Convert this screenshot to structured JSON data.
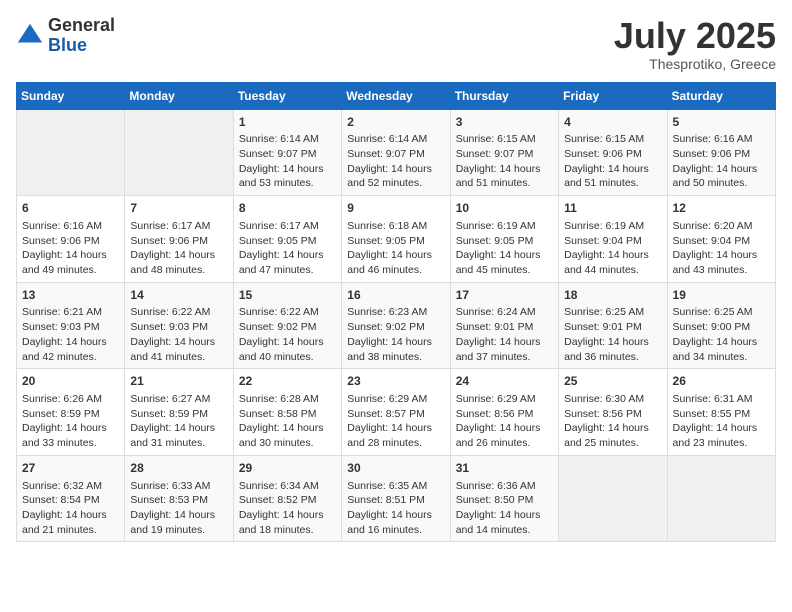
{
  "header": {
    "logo_general": "General",
    "logo_blue": "Blue",
    "month_year": "July 2025",
    "location": "Thesprotiko, Greece"
  },
  "weekdays": [
    "Sunday",
    "Monday",
    "Tuesday",
    "Wednesday",
    "Thursday",
    "Friday",
    "Saturday"
  ],
  "weeks": [
    [
      {
        "day": "",
        "sunrise": "",
        "sunset": "",
        "daylight": ""
      },
      {
        "day": "",
        "sunrise": "",
        "sunset": "",
        "daylight": ""
      },
      {
        "day": "1",
        "sunrise": "Sunrise: 6:14 AM",
        "sunset": "Sunset: 9:07 PM",
        "daylight": "Daylight: 14 hours and 53 minutes."
      },
      {
        "day": "2",
        "sunrise": "Sunrise: 6:14 AM",
        "sunset": "Sunset: 9:07 PM",
        "daylight": "Daylight: 14 hours and 52 minutes."
      },
      {
        "day": "3",
        "sunrise": "Sunrise: 6:15 AM",
        "sunset": "Sunset: 9:07 PM",
        "daylight": "Daylight: 14 hours and 51 minutes."
      },
      {
        "day": "4",
        "sunrise": "Sunrise: 6:15 AM",
        "sunset": "Sunset: 9:06 PM",
        "daylight": "Daylight: 14 hours and 51 minutes."
      },
      {
        "day": "5",
        "sunrise": "Sunrise: 6:16 AM",
        "sunset": "Sunset: 9:06 PM",
        "daylight": "Daylight: 14 hours and 50 minutes."
      }
    ],
    [
      {
        "day": "6",
        "sunrise": "Sunrise: 6:16 AM",
        "sunset": "Sunset: 9:06 PM",
        "daylight": "Daylight: 14 hours and 49 minutes."
      },
      {
        "day": "7",
        "sunrise": "Sunrise: 6:17 AM",
        "sunset": "Sunset: 9:06 PM",
        "daylight": "Daylight: 14 hours and 48 minutes."
      },
      {
        "day": "8",
        "sunrise": "Sunrise: 6:17 AM",
        "sunset": "Sunset: 9:05 PM",
        "daylight": "Daylight: 14 hours and 47 minutes."
      },
      {
        "day": "9",
        "sunrise": "Sunrise: 6:18 AM",
        "sunset": "Sunset: 9:05 PM",
        "daylight": "Daylight: 14 hours and 46 minutes."
      },
      {
        "day": "10",
        "sunrise": "Sunrise: 6:19 AM",
        "sunset": "Sunset: 9:05 PM",
        "daylight": "Daylight: 14 hours and 45 minutes."
      },
      {
        "day": "11",
        "sunrise": "Sunrise: 6:19 AM",
        "sunset": "Sunset: 9:04 PM",
        "daylight": "Daylight: 14 hours and 44 minutes."
      },
      {
        "day": "12",
        "sunrise": "Sunrise: 6:20 AM",
        "sunset": "Sunset: 9:04 PM",
        "daylight": "Daylight: 14 hours and 43 minutes."
      }
    ],
    [
      {
        "day": "13",
        "sunrise": "Sunrise: 6:21 AM",
        "sunset": "Sunset: 9:03 PM",
        "daylight": "Daylight: 14 hours and 42 minutes."
      },
      {
        "day": "14",
        "sunrise": "Sunrise: 6:22 AM",
        "sunset": "Sunset: 9:03 PM",
        "daylight": "Daylight: 14 hours and 41 minutes."
      },
      {
        "day": "15",
        "sunrise": "Sunrise: 6:22 AM",
        "sunset": "Sunset: 9:02 PM",
        "daylight": "Daylight: 14 hours and 40 minutes."
      },
      {
        "day": "16",
        "sunrise": "Sunrise: 6:23 AM",
        "sunset": "Sunset: 9:02 PM",
        "daylight": "Daylight: 14 hours and 38 minutes."
      },
      {
        "day": "17",
        "sunrise": "Sunrise: 6:24 AM",
        "sunset": "Sunset: 9:01 PM",
        "daylight": "Daylight: 14 hours and 37 minutes."
      },
      {
        "day": "18",
        "sunrise": "Sunrise: 6:25 AM",
        "sunset": "Sunset: 9:01 PM",
        "daylight": "Daylight: 14 hours and 36 minutes."
      },
      {
        "day": "19",
        "sunrise": "Sunrise: 6:25 AM",
        "sunset": "Sunset: 9:00 PM",
        "daylight": "Daylight: 14 hours and 34 minutes."
      }
    ],
    [
      {
        "day": "20",
        "sunrise": "Sunrise: 6:26 AM",
        "sunset": "Sunset: 8:59 PM",
        "daylight": "Daylight: 14 hours and 33 minutes."
      },
      {
        "day": "21",
        "sunrise": "Sunrise: 6:27 AM",
        "sunset": "Sunset: 8:59 PM",
        "daylight": "Daylight: 14 hours and 31 minutes."
      },
      {
        "day": "22",
        "sunrise": "Sunrise: 6:28 AM",
        "sunset": "Sunset: 8:58 PM",
        "daylight": "Daylight: 14 hours and 30 minutes."
      },
      {
        "day": "23",
        "sunrise": "Sunrise: 6:29 AM",
        "sunset": "Sunset: 8:57 PM",
        "daylight": "Daylight: 14 hours and 28 minutes."
      },
      {
        "day": "24",
        "sunrise": "Sunrise: 6:29 AM",
        "sunset": "Sunset: 8:56 PM",
        "daylight": "Daylight: 14 hours and 26 minutes."
      },
      {
        "day": "25",
        "sunrise": "Sunrise: 6:30 AM",
        "sunset": "Sunset: 8:56 PM",
        "daylight": "Daylight: 14 hours and 25 minutes."
      },
      {
        "day": "26",
        "sunrise": "Sunrise: 6:31 AM",
        "sunset": "Sunset: 8:55 PM",
        "daylight": "Daylight: 14 hours and 23 minutes."
      }
    ],
    [
      {
        "day": "27",
        "sunrise": "Sunrise: 6:32 AM",
        "sunset": "Sunset: 8:54 PM",
        "daylight": "Daylight: 14 hours and 21 minutes."
      },
      {
        "day": "28",
        "sunrise": "Sunrise: 6:33 AM",
        "sunset": "Sunset: 8:53 PM",
        "daylight": "Daylight: 14 hours and 19 minutes."
      },
      {
        "day": "29",
        "sunrise": "Sunrise: 6:34 AM",
        "sunset": "Sunset: 8:52 PM",
        "daylight": "Daylight: 14 hours and 18 minutes."
      },
      {
        "day": "30",
        "sunrise": "Sunrise: 6:35 AM",
        "sunset": "Sunset: 8:51 PM",
        "daylight": "Daylight: 14 hours and 16 minutes."
      },
      {
        "day": "31",
        "sunrise": "Sunrise: 6:36 AM",
        "sunset": "Sunset: 8:50 PM",
        "daylight": "Daylight: 14 hours and 14 minutes."
      },
      {
        "day": "",
        "sunrise": "",
        "sunset": "",
        "daylight": ""
      },
      {
        "day": "",
        "sunrise": "",
        "sunset": "",
        "daylight": ""
      }
    ]
  ]
}
